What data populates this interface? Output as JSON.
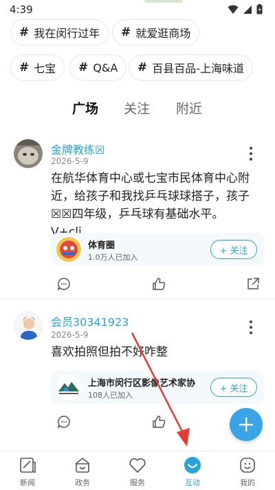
{
  "status_bar": {
    "time": "4:39"
  },
  "topics": [
    {
      "label": "我在闵行过年"
    },
    {
      "label": "就爱逛商场"
    },
    {
      "label": "七宝"
    },
    {
      "label": "Q&A"
    },
    {
      "label": "百县百品-上海味道"
    }
  ],
  "tabs": [
    {
      "label": "广场"
    },
    {
      "label": "关注"
    },
    {
      "label": "附近"
    }
  ],
  "posts": [
    {
      "username": "金牌教练☒",
      "date": "2026-5-9",
      "text": "在航华体育中心或七宝市民体育中心附近，给孩子和我找乒乓球球搭子，孩子☒☒四年级，乒乓球有基础水平。V+cli...",
      "circle": {
        "name": "体育圈",
        "members": "1.0万人已加入",
        "follow_label": "+ 关注"
      }
    },
    {
      "username": "会员30341923",
      "date": "2026-5-9",
      "text": "喜欢拍照但拍不好咋整",
      "circle": {
        "name": "上海市闵行区影像艺术家协",
        "members": "108人已加入",
        "follow_label": "+ 关注"
      }
    }
  ],
  "bottom_nav": [
    {
      "label": "新闻",
      "icon": "news-icon"
    },
    {
      "label": "政务",
      "icon": "government-icon"
    },
    {
      "label": "服务",
      "icon": "heart-icon"
    },
    {
      "label": "互动",
      "icon": "interact-icon",
      "active": true
    },
    {
      "label": "我的",
      "icon": "profile-face-icon"
    }
  ],
  "colors": {
    "accent": "#2aa3d9",
    "fab": "#3aa4e6",
    "annotation_arrow": "#e53935"
  }
}
